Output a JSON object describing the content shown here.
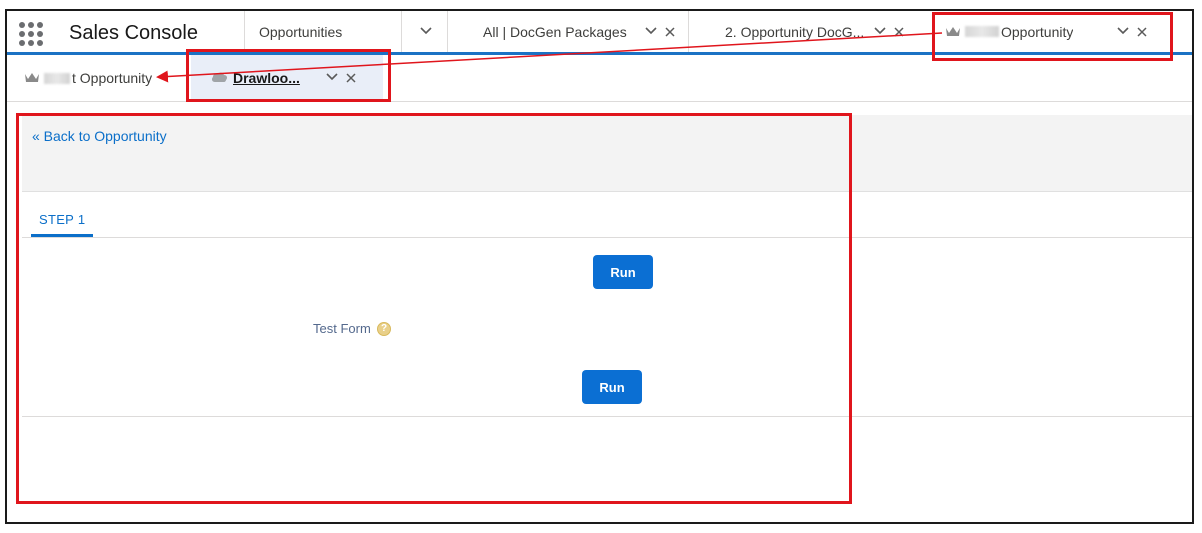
{
  "app": {
    "name": "Sales Console"
  },
  "nav": {
    "items": [
      {
        "label": "Opportunities",
        "has_close": false
      },
      {
        "label": "All | DocGen Packages",
        "has_close": true
      },
      {
        "label": "2. Opportunity DocG...",
        "has_close": true
      },
      {
        "label": "Opportunity",
        "has_close": true,
        "redacted_prefix": true,
        "icon": "crown-icon"
      }
    ]
  },
  "subtabs": [
    {
      "label": "t Opportunity",
      "redacted_prefix": true,
      "icon": "crown-icon"
    },
    {
      "label": "Drawloo...",
      "active": true,
      "icon": "cloud-icon"
    }
  ],
  "page": {
    "back_link": "« Back to Opportunity",
    "step_tab": "STEP 1",
    "run_label_1": "Run",
    "form_label": "Test Form",
    "help_icon": "?",
    "run_label_2": "Run"
  },
  "colors": {
    "brand_blue": "#1b72c4",
    "button_blue": "#0b6fd3",
    "annotation_red": "#e0151c"
  }
}
